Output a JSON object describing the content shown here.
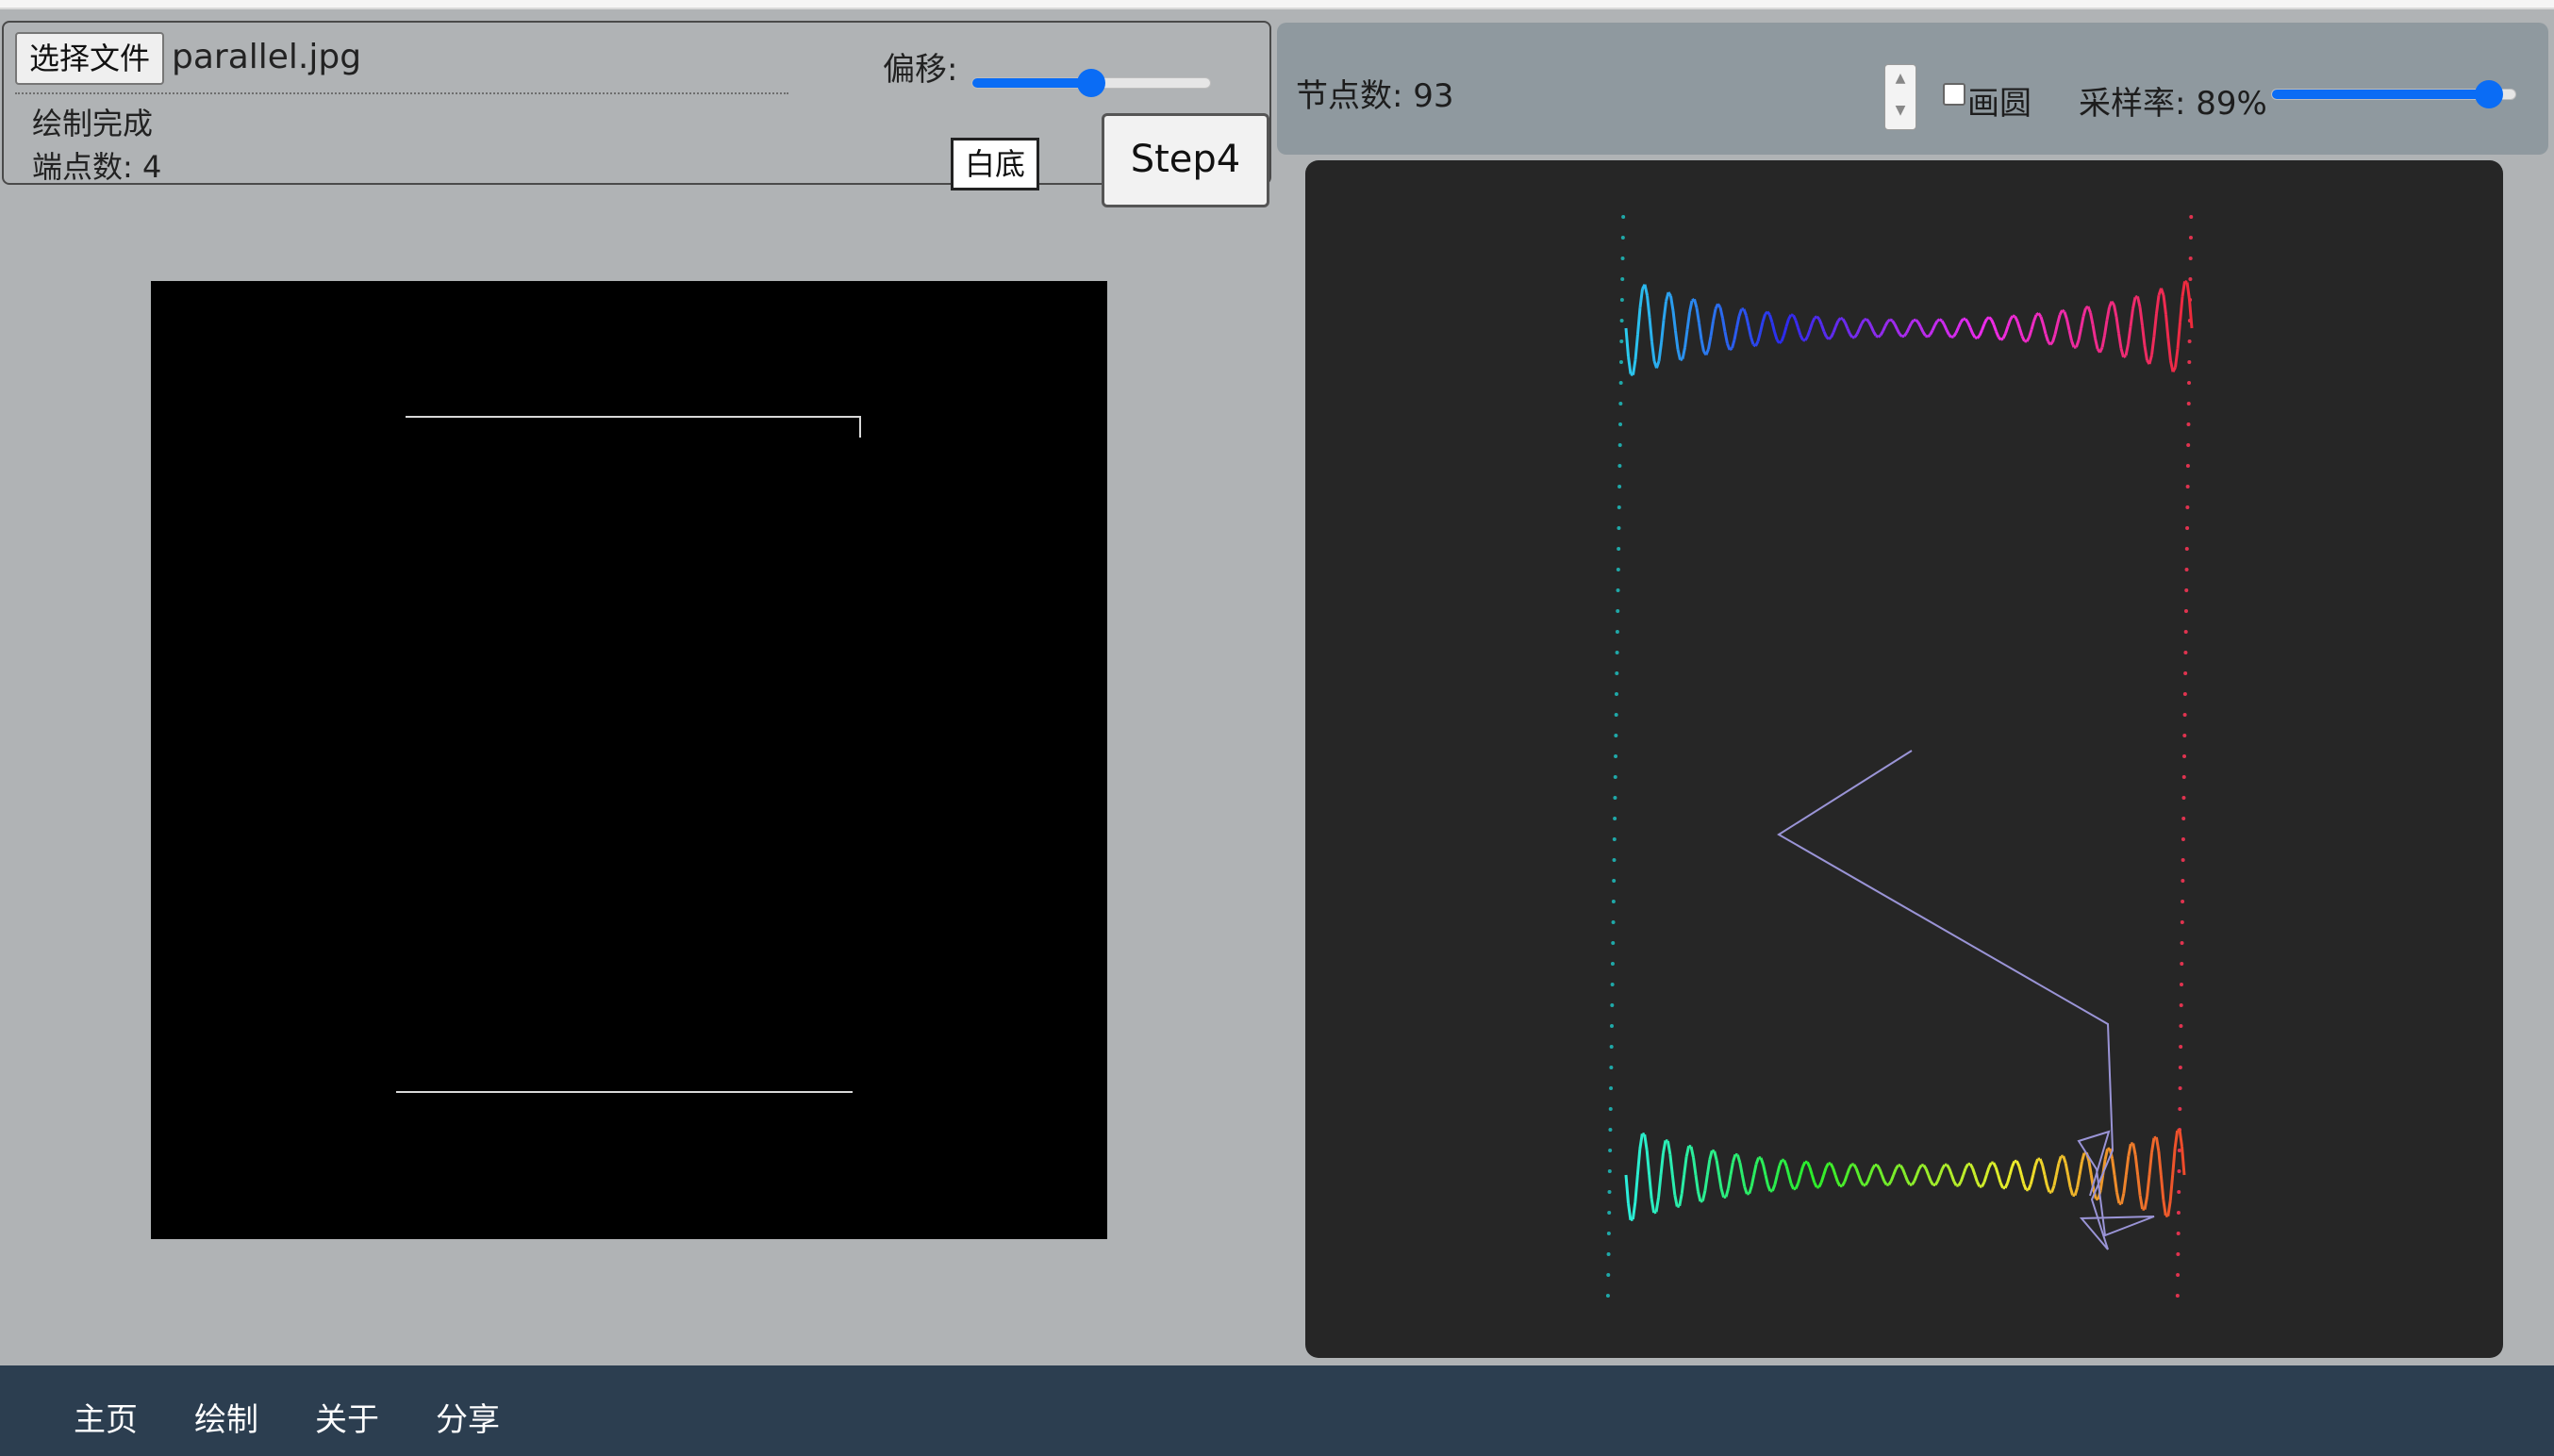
{
  "left_panel": {
    "choose_file_label": "选择文件",
    "file_name": "parallel.jpg",
    "status": "绘制完成",
    "endpoint_count": "端点数: 4",
    "offset_label": "偏移:",
    "offset_value": 0.5,
    "white_bg_label": "白底",
    "step_label": "Step4"
  },
  "right_panel": {
    "node_count": "节点数: 93",
    "circle_label": "画圆",
    "circle_checked": false,
    "sample_label": "采样率: 89%",
    "sample_value": 0.89
  },
  "nav": {
    "items": [
      "主页",
      "绘制",
      "关于",
      "分享"
    ]
  },
  "colors": {
    "accent": "#0a6cf5",
    "panel_bg": "#b0b3b5",
    "right_panel_bg": "#8f999f",
    "canvas_dark": "#262626",
    "nav_bg": "#2c3e50",
    "epicycle_line": "#9a94d6"
  }
}
